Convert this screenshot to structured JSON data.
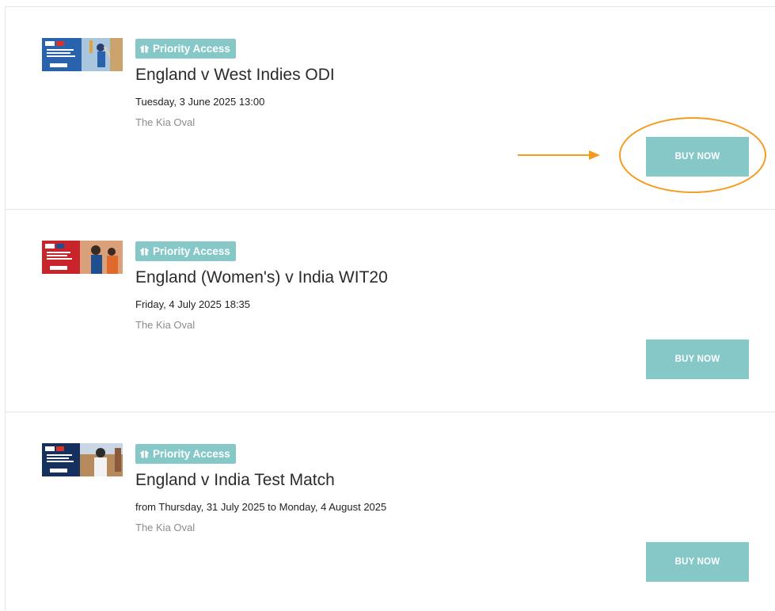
{
  "colors": {
    "accent": "#86c8c8",
    "annotation": "#f39c1f",
    "divider": "#e6e6e6"
  },
  "events": [
    {
      "badge": "Priority Access",
      "title": "England v West Indies ODI",
      "date": "Tuesday, 3 June 2025 13:00",
      "venue": "The Kia Oval",
      "button": "BUY NOW",
      "thumbnail_icon": "cricket-poster-thumbnail"
    },
    {
      "badge": "Priority Access",
      "title": "England (Women's) v India WIT20",
      "date": "Friday, 4 July 2025 18:35",
      "venue": "The Kia Oval",
      "button": "BUY NOW",
      "thumbnail_icon": "cricket-poster-thumbnail"
    },
    {
      "badge": "Priority Access",
      "title": "England v India Test Match",
      "date": "from Thursday, 31 July 2025 to Monday, 4 August 2025",
      "venue": "The Kia Oval",
      "button": "BUY NOW",
      "thumbnail_icon": "cricket-poster-thumbnail"
    }
  ]
}
